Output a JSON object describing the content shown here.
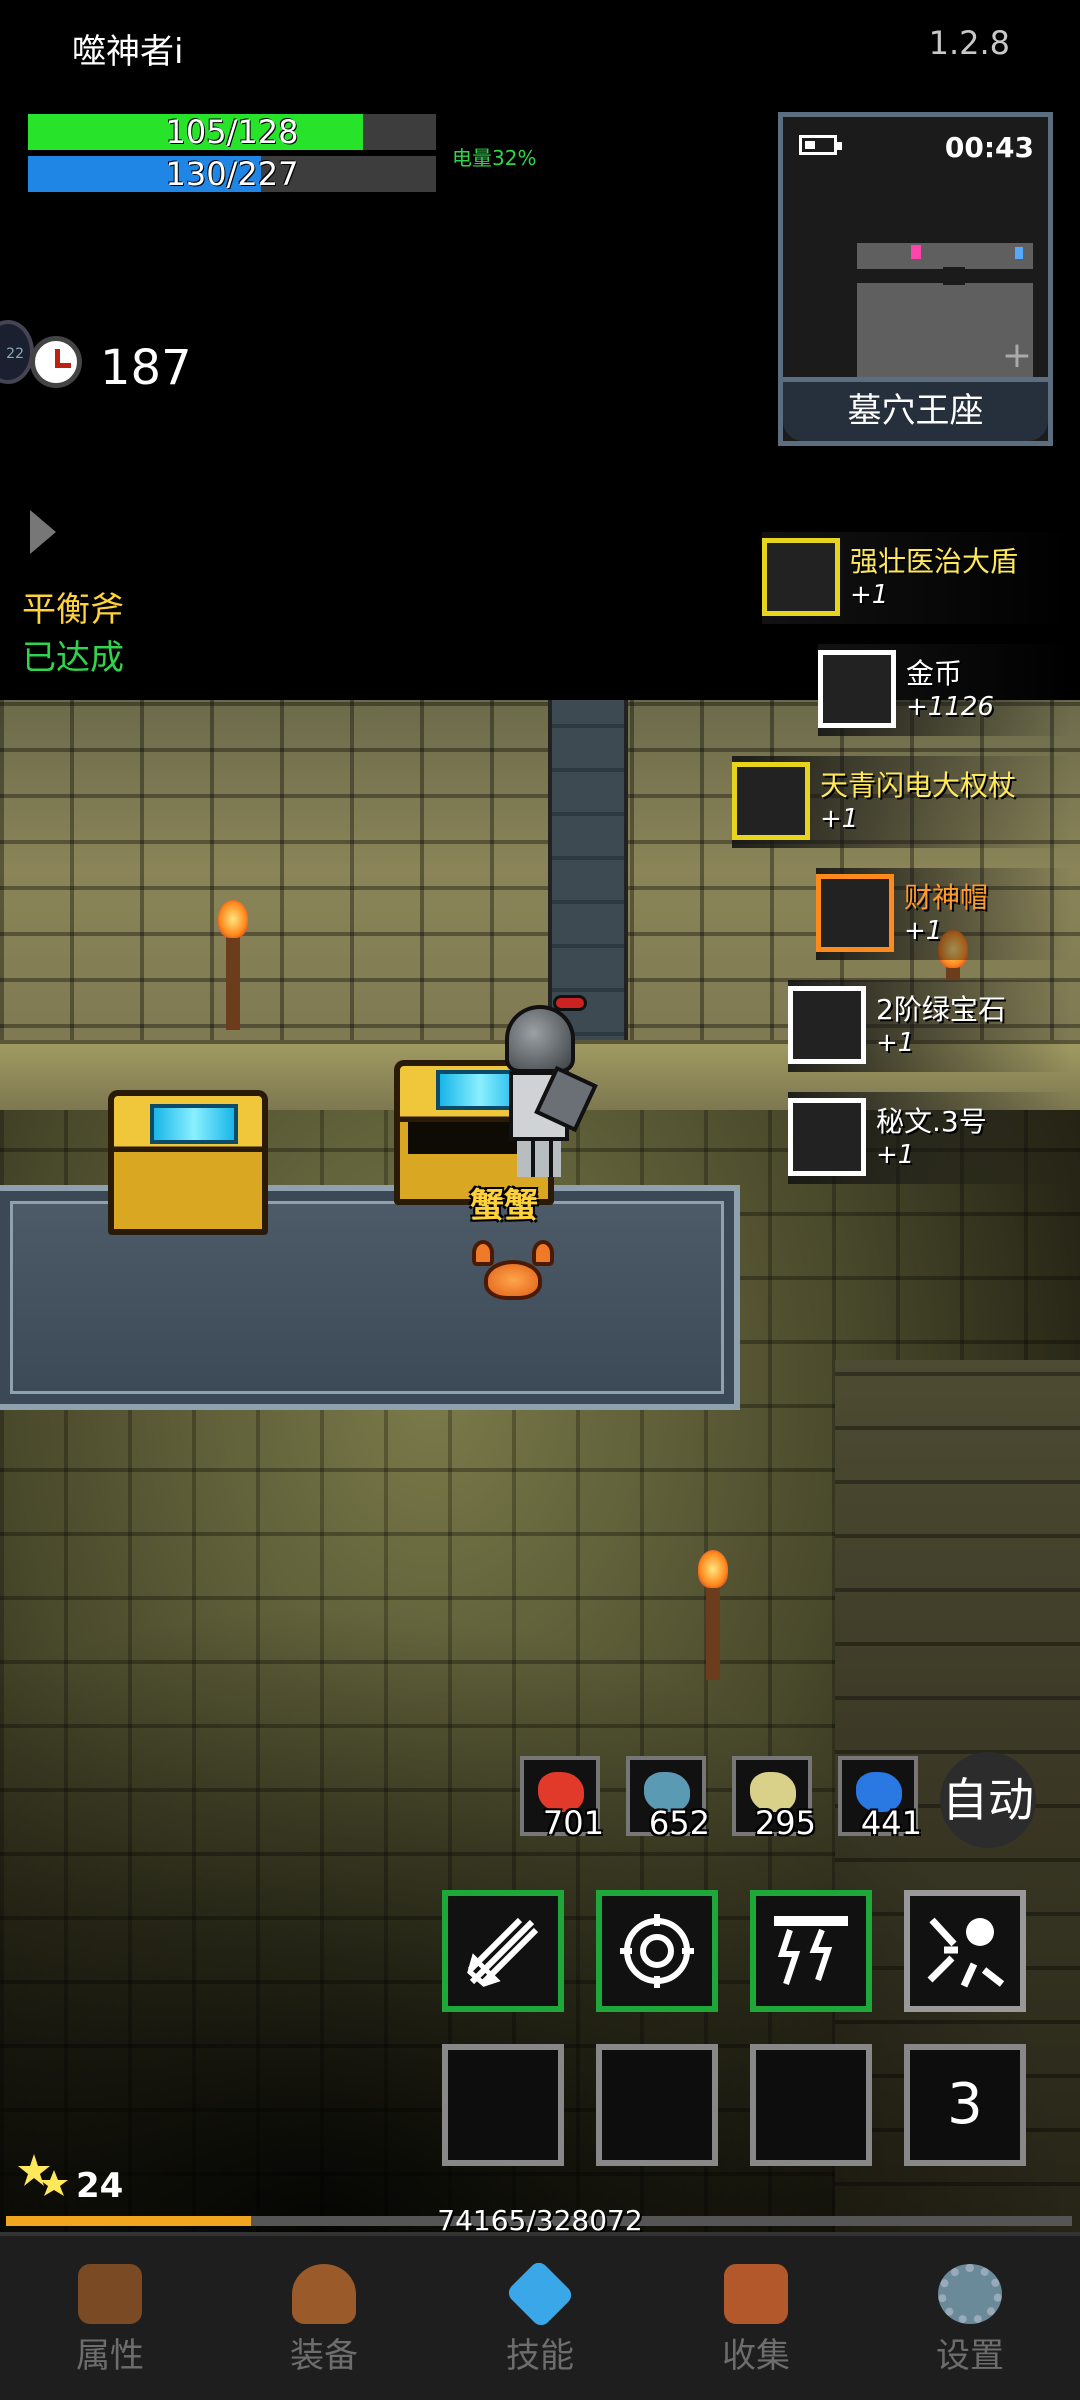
{
  "header": {
    "title": "噬神者i",
    "version": "1.2.8"
  },
  "stats": {
    "hp_text": "105/128",
    "hp_fraction": 0.82,
    "mp_text": "130/227",
    "mp_fraction": 0.57,
    "battery": "电量32%"
  },
  "timer": {
    "value": "187",
    "side_tab": "22"
  },
  "quest": {
    "name": "平衡斧",
    "status": "已达成"
  },
  "minimap": {
    "clock": "00:43",
    "location": "墓穴王座"
  },
  "loot": [
    {
      "name": "强壮医治大盾",
      "qty": "+1",
      "color": "#ffe85a",
      "icon": "shield-icon"
    },
    {
      "name": "金币",
      "qty": "+1126",
      "color": "#ffffff",
      "icon": "gold-coins-icon"
    },
    {
      "name": "天青闪电大权杖",
      "qty": "+1",
      "color": "#ffe85a",
      "icon": "scepter-icon"
    },
    {
      "name": "财神帽",
      "qty": "+1",
      "color": "#ff9a2c",
      "icon": "hat-icon"
    },
    {
      "name": "2阶绿宝石",
      "qty": "+1",
      "color": "#ffffff",
      "icon": "green-gem-icon"
    },
    {
      "name": "秘文.3号",
      "qty": "+1",
      "color": "#ffffff",
      "icon": "rune-stone-icon"
    }
  ],
  "scene": {
    "pet_name": "蟹蟹"
  },
  "consumables": [
    {
      "count": "701",
      "icon": "red-potion-icon",
      "color": "#e23a2a"
    },
    {
      "count": "652",
      "icon": "fish-icon",
      "color": "#5a9ab2"
    },
    {
      "count": "295",
      "icon": "scroll-icon",
      "color": "#d9d08a"
    },
    {
      "count": "441",
      "icon": "blue-potion-icon",
      "color": "#2a78e2"
    }
  ],
  "auto_label": "自动",
  "slot_count": "3",
  "level": {
    "value": "24",
    "xp_text": "74165/328072",
    "xp_fraction": 0.23
  },
  "nav": [
    {
      "label": "属性",
      "icon": "helmet-icon"
    },
    {
      "label": "装备",
      "icon": "bag-icon"
    },
    {
      "label": "技能",
      "icon": "crystal-icon"
    },
    {
      "label": "收集",
      "icon": "book-icon"
    },
    {
      "label": "设置",
      "icon": "gear-icon"
    }
  ],
  "colors": {
    "hp": "#27e32a",
    "mp": "#1f86e6",
    "xp": "#f2a51e",
    "skill_ready": "#1fa83a"
  }
}
